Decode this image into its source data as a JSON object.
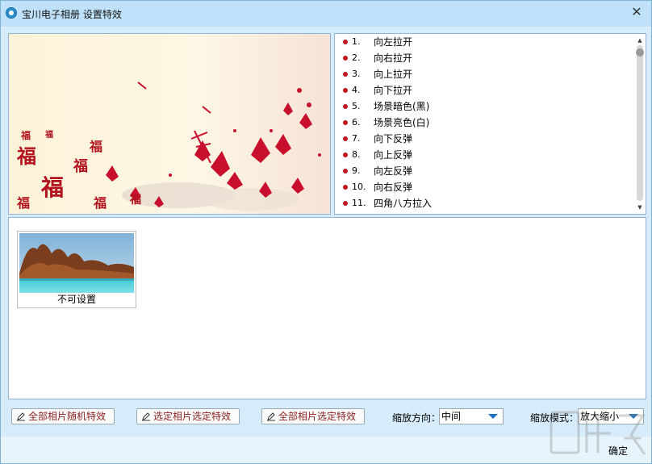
{
  "window": {
    "title": "宝川电子相册  设置特效",
    "close_glyph": "✕"
  },
  "effects": {
    "items": [
      {
        "num": "1.",
        "label": "向左拉开"
      },
      {
        "num": "2.",
        "label": "向右拉开"
      },
      {
        "num": "3.",
        "label": "向上拉开"
      },
      {
        "num": "4.",
        "label": "向下拉开"
      },
      {
        "num": "5.",
        "label": "场景暗色(黑)"
      },
      {
        "num": "6.",
        "label": "场景亮色(白)"
      },
      {
        "num": "7.",
        "label": "向下反弹"
      },
      {
        "num": "8.",
        "label": "向上反弹"
      },
      {
        "num": "9.",
        "label": "向左反弹"
      },
      {
        "num": "10.",
        "label": "向右反弹"
      },
      {
        "num": "11.",
        "label": "四角八方拉入"
      }
    ],
    "bullet_color": "#c0161f"
  },
  "photos": [
    {
      "caption": "不可设置"
    }
  ],
  "toolbar": {
    "random_all_label": "全部相片随机特效",
    "selected_photo_label": "选定相片选定特效",
    "all_selected_label": "全部相片选定特效",
    "zoom_direction_label": "缩放方向：",
    "zoom_direction_value": "中间",
    "zoom_mode_label": "缩放模式：",
    "zoom_mode_value": "放大缩小"
  },
  "footer": {
    "ok_label": "确定"
  },
  "colors": {
    "titlebar": "#bfe2fa",
    "background": "#d6ecfa",
    "accent": "#1d6fc1",
    "button_text": "#8a1f1f"
  }
}
